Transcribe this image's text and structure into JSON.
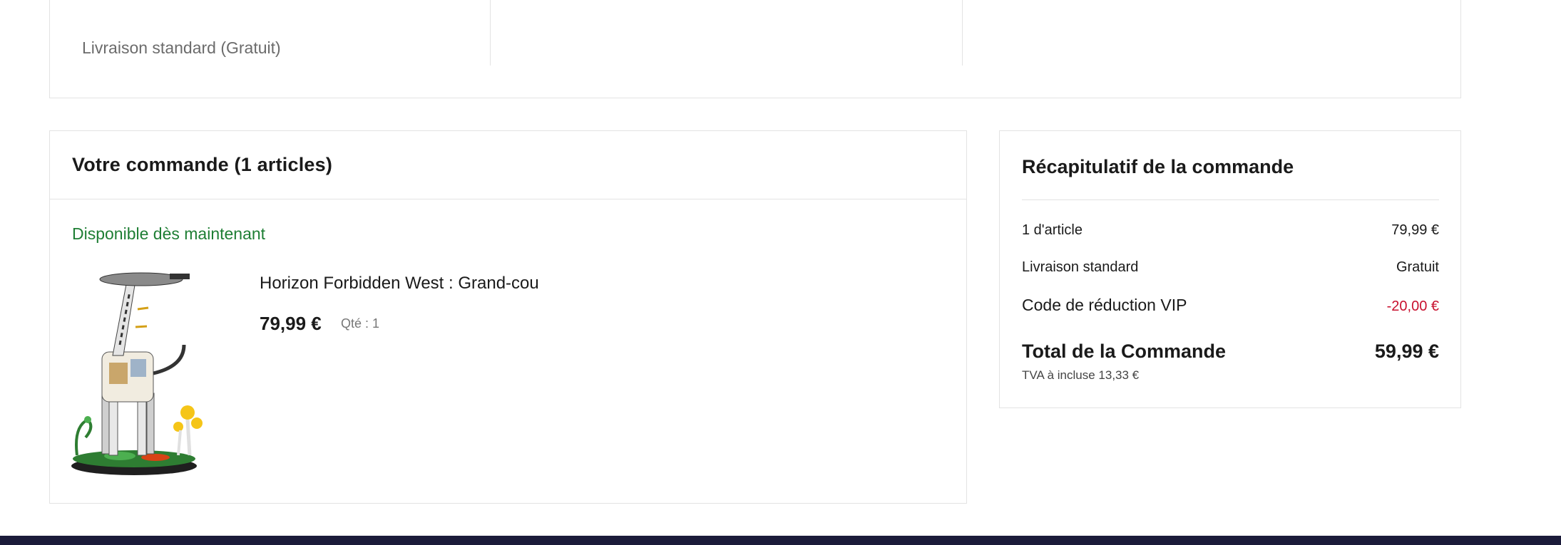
{
  "shipping": {
    "option_label": "Livraison standard (Gratuit)"
  },
  "order": {
    "title": "Votre commande (1 articles)",
    "availability": "Disponible dès maintenant",
    "item": {
      "name": "Horizon Forbidden West : Grand-cou",
      "price": "79,99 €",
      "qty": "Qté : 1"
    }
  },
  "summary": {
    "title": "Récapitulatif de la commande",
    "rows": [
      {
        "label": "1 d'article",
        "value": "79,99 €"
      },
      {
        "label": "Livraison standard",
        "value": "Gratuit"
      },
      {
        "label": "Code de réduction VIP",
        "value": "-20,00 €"
      }
    ],
    "total_label": "Total de la Commande",
    "total_value": "59,99 €",
    "vat_note": "TVA à incluse 13,33 €"
  },
  "colors": {
    "availability_green": "#1e7e34",
    "discount_red": "#c8102e",
    "footer_navy": "#1b1b3a",
    "border": "#e3e3e3"
  }
}
